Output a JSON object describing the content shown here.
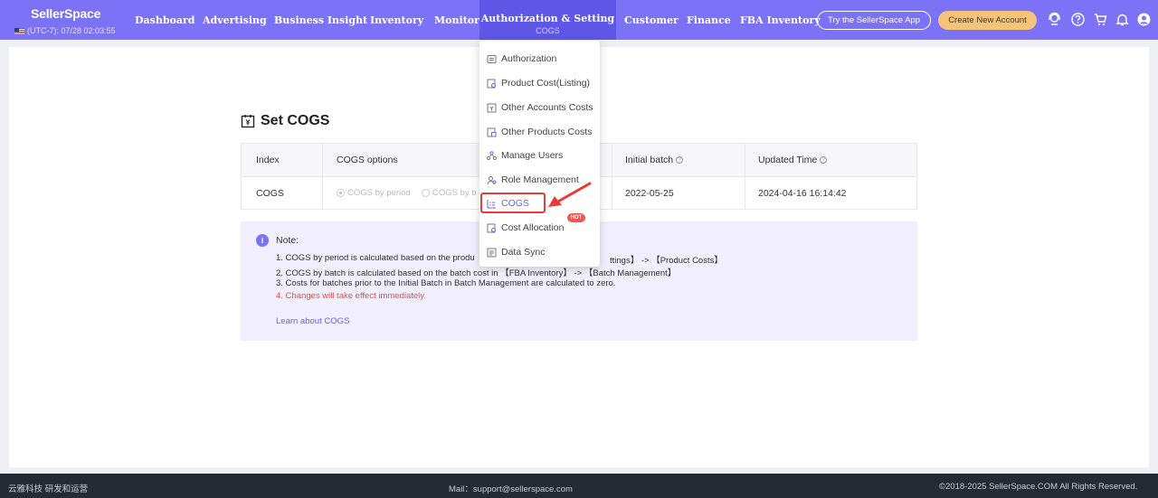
{
  "header": {
    "logo": "SellerSpace",
    "timezone": "(UTC-7): 07/28 02:03:55",
    "nav": [
      {
        "label": "Dashboard"
      },
      {
        "label": "Advertising"
      },
      {
        "label": "Business Insight"
      },
      {
        "label": "Inventory"
      },
      {
        "label": "Monitor"
      },
      {
        "label": "Authorization & Setting",
        "sub": "COGS",
        "active": true
      },
      {
        "label": "Customer"
      },
      {
        "label": "Finance"
      },
      {
        "label": "FBA Inventory"
      }
    ],
    "app_button": "Try the SellerSpace App",
    "create_button": "Create New Account",
    "icons": [
      "support-icon",
      "help-icon",
      "cart-icon",
      "bell-icon",
      "user-icon"
    ]
  },
  "dropdown": {
    "items": [
      {
        "label": "Authorization",
        "icon": "authorization-icon"
      },
      {
        "label": "Product Cost(Listing)",
        "icon": "product-cost-icon"
      },
      {
        "label": "Other Accounts Costs",
        "icon": "accounts-costs-icon"
      },
      {
        "label": "Other Products Costs",
        "icon": "products-costs-icon"
      },
      {
        "label": "Manage Users",
        "icon": "users-icon"
      },
      {
        "label": "Role Management",
        "icon": "role-icon"
      },
      {
        "label": "COGS",
        "icon": "cogs-icon",
        "active": true
      },
      {
        "label": "Cost Allocation",
        "icon": "cost-allocation-icon",
        "badge": "HOT"
      },
      {
        "label": "Data Sync",
        "icon": "data-sync-icon"
      }
    ]
  },
  "main": {
    "title": "Set COGS",
    "table": {
      "headers": [
        "Index",
        "COGS options",
        "Initial batch",
        "Updated Time"
      ],
      "row": {
        "index": "COGS",
        "option_period": "COGS by period",
        "option_batch": "COGS by b",
        "initial_batch": "2022-05-25",
        "updated_time": "2024-04-16 16:14:42"
      }
    },
    "note": {
      "title": "Note:",
      "lines": [
        "1. COGS by period is calculated based on the produ",
        "ttings】 -> 【Product Costs】",
        "2. COGS by batch is calculated based on the batch cost in 【FBA Inventory】 -> 【Batch Management】",
        "3. Costs for batches prior to the Initial Batch in Batch Management are calculated to zero.",
        "4. Changes will take effect immediately."
      ],
      "link": "Learn about COGS"
    }
  },
  "footer": {
    "left": "云雅科技 研发和运营",
    "mail": "Mail：support@sellerspace.com",
    "copyright": "©2018-2025 SellerSpace.COM All Rights Reserved."
  },
  "colors": {
    "header": "#7b72f5",
    "active_nav": "#5f57e8",
    "accent": "#6a63e6",
    "highlight": "#ea3a3a",
    "gold": "#f6c37a",
    "footer": "#262a33"
  }
}
